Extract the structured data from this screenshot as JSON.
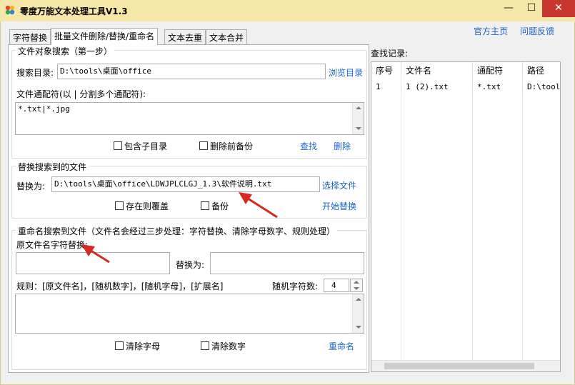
{
  "window": {
    "title": "零度万能文本处理工具V1.3",
    "minimize": "—",
    "maximize": "☐",
    "close": "✕"
  },
  "tabs": [
    {
      "label": "字符替换"
    },
    {
      "label": "批量文件删除/替换/重命名"
    },
    {
      "label": "文本去重"
    },
    {
      "label": "文本合并"
    }
  ],
  "top_links": {
    "home": "官方主页",
    "feedback": "问题反馈"
  },
  "search_group": {
    "legend": "文件对象搜索（第一步）",
    "dir_label": "搜索目录:",
    "dir_value": "D:\\tools\\桌面\\office",
    "browse": "浏览目录",
    "pattern_label": "文件通配符(以 | 分割多个通配符):",
    "pattern_value": "*.txt|*.jpg",
    "include_subdirs": "包含子目录",
    "backup_before_delete": "删除前备份",
    "find": "查找",
    "delete": "删除"
  },
  "replace_group": {
    "legend": "替换搜索到的文件",
    "replace_label": "替换为:",
    "replace_value": "D:\\tools\\桌面\\office\\LDWJPLCLGJ_1.3\\软件说明.txt",
    "select_file": "选择文件",
    "overwrite_if_exists": "存在则覆盖",
    "backup": "备份",
    "start_replace": "开始替换"
  },
  "rename_group": {
    "legend": "重命名搜索到文件（文件名会经过三步处理：字符替换、清除字母数字、规则处理）",
    "orig_label": "原文件名字符替换:",
    "orig_value": "",
    "replace_with_label": "替换为:",
    "replace_with_value": "",
    "rule_label": "规则：[原文件名]，[随机数字]，[随机字母]，[扩展名]",
    "rand_count_label": "随机字符数:",
    "rand_count_value": "4",
    "rule_value": "",
    "clear_letters": "清除字母",
    "clear_digits": "清除数字",
    "rename": "重命名"
  },
  "results": {
    "title": "查找记录:",
    "columns": [
      "序号",
      "文件名",
      "通配符",
      "路径"
    ],
    "rows": [
      [
        "1",
        "1 (2).txt",
        "*.txt",
        "D:\\tools\\桌面\\office"
      ]
    ]
  },
  "colors": {
    "titlebar": "#f5e7a8",
    "link": "#1a64c8",
    "close": "#c7372f",
    "arrow": "#d42a22"
  }
}
